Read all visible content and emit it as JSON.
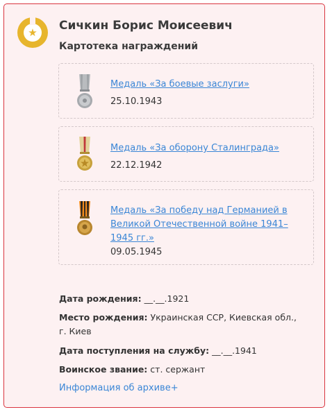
{
  "person": {
    "name": "Сичкин Борис Моисеевич",
    "section_title": "Картотека награждений"
  },
  "awards": [
    {
      "title": "Медаль «За боевые заслуги»",
      "date": "25.10.1943",
      "icon": "medal-combat-merit-icon"
    },
    {
      "title": "Медаль «За оборону Сталинграда»",
      "date": "22.12.1942",
      "icon": "medal-stalingrad-defense-icon"
    },
    {
      "title": "Медаль «За победу над Германией в Великой Отечественной войне 1941–1945 гг.»",
      "date": "09.05.1945",
      "icon": "medal-victory-over-germany-icon"
    }
  ],
  "details": {
    "birth_date_label": "Дата рождения:",
    "birth_date_value": "__.__.1921",
    "birth_place_label": "Место рождения:",
    "birth_place_value": "Украинская ССР, Киевская обл., г. Киев",
    "service_start_label": "Дата поступления на службу:",
    "service_start_value": "__.__.1941",
    "rank_label": "Воинское звание:",
    "rank_value": "ст. сержант"
  },
  "archive_link": "Информация об архиве+",
  "colors": {
    "card_background": "#fdf1f2",
    "card_border": "#d9343f",
    "badge_gold": "#e7b52d",
    "link": "#3a86d6"
  }
}
